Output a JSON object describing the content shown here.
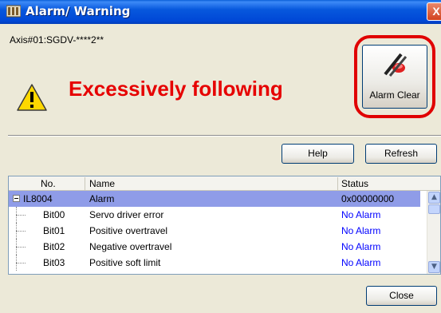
{
  "window": {
    "title": "Alarm/ Warning",
    "title_bar_color": "#0a58dd",
    "close_glyph": "X"
  },
  "axis": {
    "label": "Axis#01:SGDV-****2**"
  },
  "alarm": {
    "message": "Excessively following",
    "message_color": "#e60000",
    "icon": "warning-triangle-icon"
  },
  "toolbar": {
    "alarm_clear_label": "Alarm Clear",
    "alarm_clear_icon": "alarm-clear-icon",
    "highlight_color": "#e00000",
    "help_label": "Help",
    "refresh_label": "Refresh",
    "close_label": "Close"
  },
  "table": {
    "columns": [
      "No.",
      "Name",
      "Status"
    ],
    "rows": [
      {
        "no": "IL8004",
        "name": "Alarm",
        "status": "0x00000000",
        "selected": true,
        "expander": "minus"
      },
      {
        "no": "Bit00",
        "name": "Servo driver error",
        "status": "No Alarm"
      },
      {
        "no": "Bit01",
        "name": "Positive overtravel",
        "status": "No Alarm"
      },
      {
        "no": "Bit02",
        "name": "Negative overtravel",
        "status": "No Alarm"
      },
      {
        "no": "Bit03",
        "name": "Positive soft limit",
        "status": "No Alarm"
      }
    ],
    "selected_row_color": "#8f9ce8",
    "status_ok_color": "#0000ff"
  },
  "scrollbar": {
    "up_icon": "scroll-up-arrow-icon",
    "down_icon": "scroll-down-arrow-icon"
  }
}
